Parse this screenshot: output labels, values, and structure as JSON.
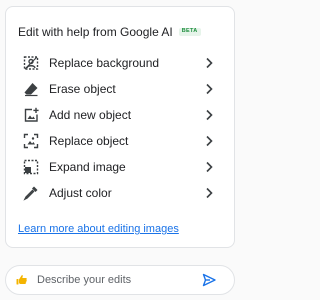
{
  "panel": {
    "title": "Edit with help from Google AI",
    "badge": "BETA",
    "items": [
      {
        "label": "Replace background",
        "icon": "replace-background-icon"
      },
      {
        "label": "Erase object",
        "icon": "eraser-icon"
      },
      {
        "label": "Add new object",
        "icon": "add-image-icon"
      },
      {
        "label": "Replace object",
        "icon": "replace-object-icon"
      },
      {
        "label": "Expand image",
        "icon": "expand-image-icon"
      },
      {
        "label": "Adjust color",
        "icon": "color-picker-icon"
      }
    ],
    "learn_more": "Learn more about editing images"
  },
  "input": {
    "placeholder": "Describe your edits"
  },
  "colors": {
    "accent": "#1a73e8",
    "badge_text": "#1e8e3e",
    "badge_bg": "#e6f4ea",
    "hand": "#f4b400"
  }
}
